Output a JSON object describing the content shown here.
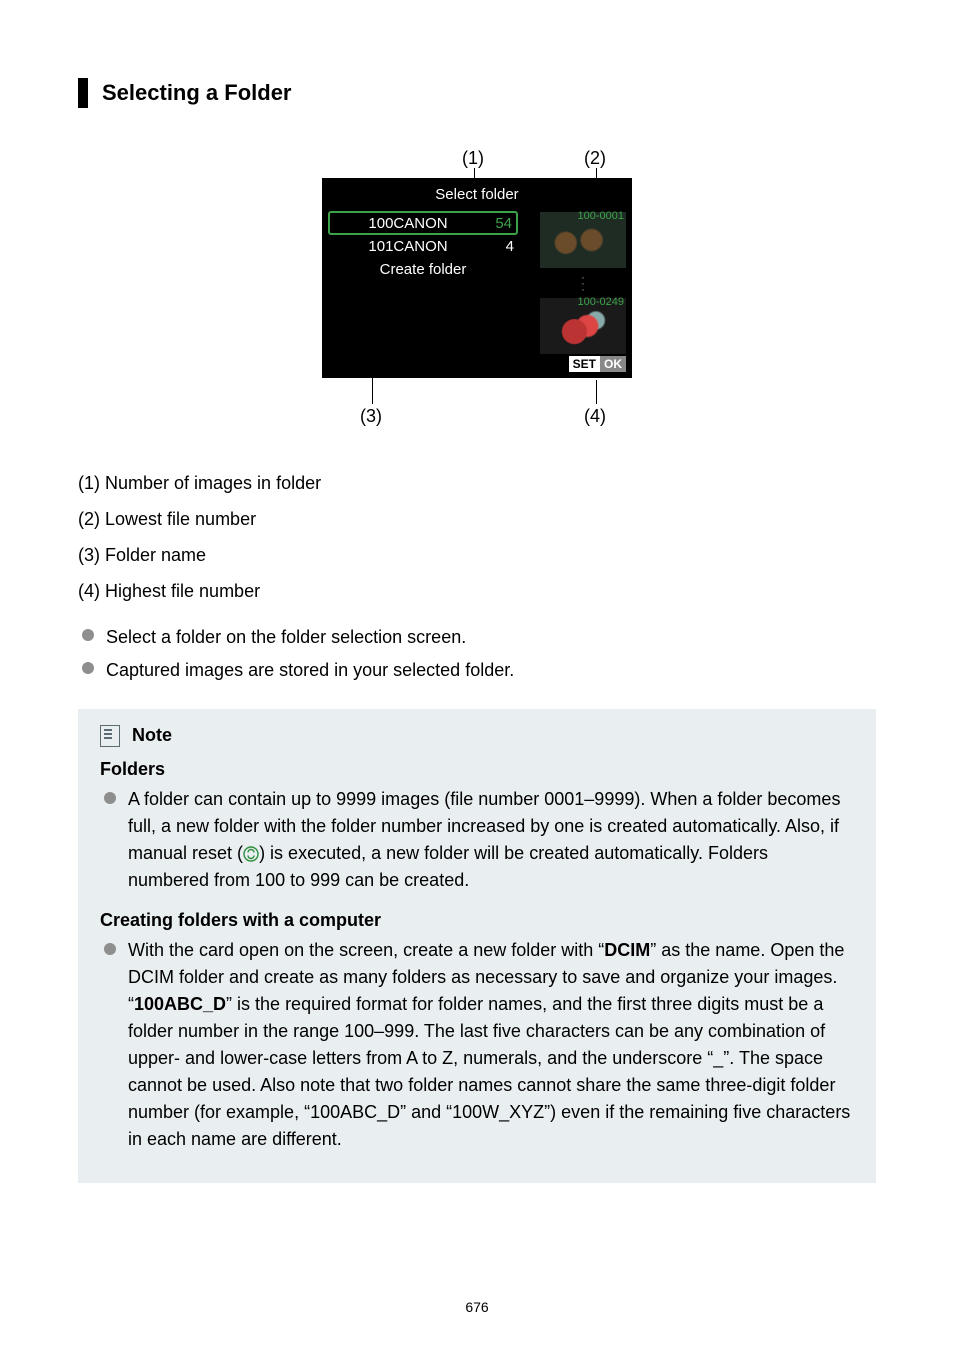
{
  "heading": "Selecting a Folder",
  "camera": {
    "title": "Select folder",
    "rows": [
      {
        "name": "100CANON",
        "count": "54",
        "selected": true
      },
      {
        "name": "101CANON",
        "count": "4",
        "selected": false
      }
    ],
    "create": "Create folder",
    "thumb1_label": "100-0001",
    "thumb2_label": "100-0249",
    "set": "SET",
    "ok": "OK"
  },
  "pointers": {
    "p1": "(1)",
    "p2": "(2)",
    "p3": "(3)",
    "p4": "(4)"
  },
  "legend": {
    "l1": "(1) Number of images in folder",
    "l2": "(2) Lowest file number",
    "l3": "(3) Folder name",
    "l4": "(4) Highest file number"
  },
  "steps": {
    "s1": "Select a folder on the folder selection screen.",
    "s2": "Captured images are stored in your selected folder."
  },
  "note": {
    "title": "Note",
    "folders_h": "Folders",
    "folders_p_a": "A folder can contain up to 9999 images (file number 0001–9999). When a folder becomes full, a new folder with the folder number increased by one is created automatically. Also, if manual reset (",
    "folders_p_b": ") is executed, a new folder will be created automatically. Folders numbered from 100 to 999 can be created.",
    "creating_h": "Creating folders with a computer",
    "creating_p_a": "With the card open on the screen, create a new folder with “",
    "creating_dcim": "DCIM",
    "creating_p_b": "” as the name. Open the DCIM folder and create as many folders as necessary to save and organize your images. “",
    "creating_fmt": "100ABC_D",
    "creating_p_c": "” is the required format for folder names, and the first three digits must be a folder number in the range 100–999. The last five characters can be any combination of upper- and lower-case letters from A to Z, numerals, and the underscore “_”. The space cannot be used. Also note that two folder names cannot share the same three-digit folder number (for example, “100ABC_D” and “100W_XYZ”) even if the remaining five characters in each name are different."
  },
  "page_number": "676"
}
